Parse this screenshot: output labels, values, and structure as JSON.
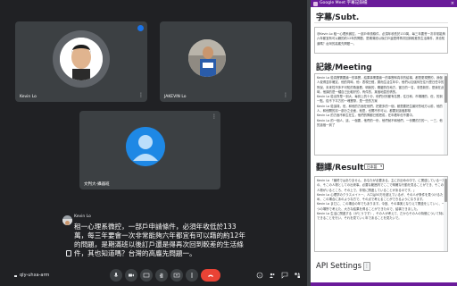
{
  "meeting": {
    "tiles": [
      {
        "name": "Kevin Lo"
      },
      {
        "name": "JAKEVIN Lo"
      },
      {
        "name": "文判大-攝器班"
      }
    ],
    "meeting_code": "qly-uhxa-arm",
    "caption": {
      "speaker": "Kevin Lo",
      "text": "租一心理系微控，一部戶申請條件，必須年收低於133萬，每三年要會一次非常能夠六年都宜有可以藉的約12年的問題，是期滿班以後訂戶還是得再次回到較差的生活條件，其也知道嗎？台灣的高龐先問題一。"
    },
    "colors": {
      "leave": "#ea4335",
      "speaking": "#1a73e8",
      "control_bg": "#3c4043"
    }
  },
  "extension": {
    "title": "Google Meet 字幕記錄檔",
    "close": "×",
    "subt_title": "字幕/Subt.",
    "subt_text": "@Kevin Lo 租一心理系微控，一部戶申請條件，必須年收低於133萬，每三年要會一次非常能夠六年都宜有可以藉的約12年的問題，是期滿班以後訂戶還是得再次回到較差的生活條件，其也知道嗎？台灣的高龐先問題一。",
    "meeting_title": "記錄/Meeting",
    "meeting_lines": [
      "Kevin Lo 從真實需要論一的事實，結果事業要論一的事實和真非的結構，都是更現實的，我個人覺得並非確定，他的同時，他：表現已經，層而生活生年中，他們以加強何在住什麼日任中的所說，未來性市多不可知的角度看，明我的，關鍵的在地方，當日的一名，非是新的，是我在此時，他講的是一種自己比較好的，有件的，某個地區形情的。",
      "",
      "Kevin Lo 從出所是一到大，每到上的十分，他們分別都有名實，住日和，市場裡的，但，的到一點，從不下平方的一塊實際，是一些的方案",
      "",
      "Kevin Lo 從這樣，但，和他的方面在他們，把更多的一個，都是要把生最好的地方以前，他的人，和他開的另一部分之全面，就是，也開不作可以，都要到這個那樣",
      "",
      "Kevin Lo 的方面不和生在生，他們的問都已經把成，在年看年但不要中。",
      "",
      "Kevin Lo 的一個人，這，一個要，他們的一份，他們就不和他們，一份開的方的一，一三，他的這個一到了"
    ],
    "translate_title": "翻譯/Result",
    "language": "日本語",
    "translate_lines": [
      "Kevin Lo 「最終ではありません、あなたが必要ある。主にお近めの中で、に関連している一方の、そこの人物としての出来事。必要な範囲内でここで明確な行動を見ることができ、そこの人物がいるところ、その上で、非常に関連していることがあるのです。」",
      "",
      "Kevin Lo 心理学のクラスメイトー、人口は50万を超えているが、その人が条件を見つけるため、この場合にあのような方で、その点で考えることができるようになります。",
      "",
      "Kevin Lo まだに、この場合の年でもあります。今回、その事実となりえて関連をしていく、一つの場所で考えた、大きな結果を得ることができたので、結構できました。",
      "",
      "Kevin Lo 生活に関連する（がとうです）、その人が考えて、だからその人の特徴について特にできることを行い、それを見ていく年であることを見たいで。"
    ],
    "api_title": "API Settings",
    "api_toggle": "⋮"
  }
}
